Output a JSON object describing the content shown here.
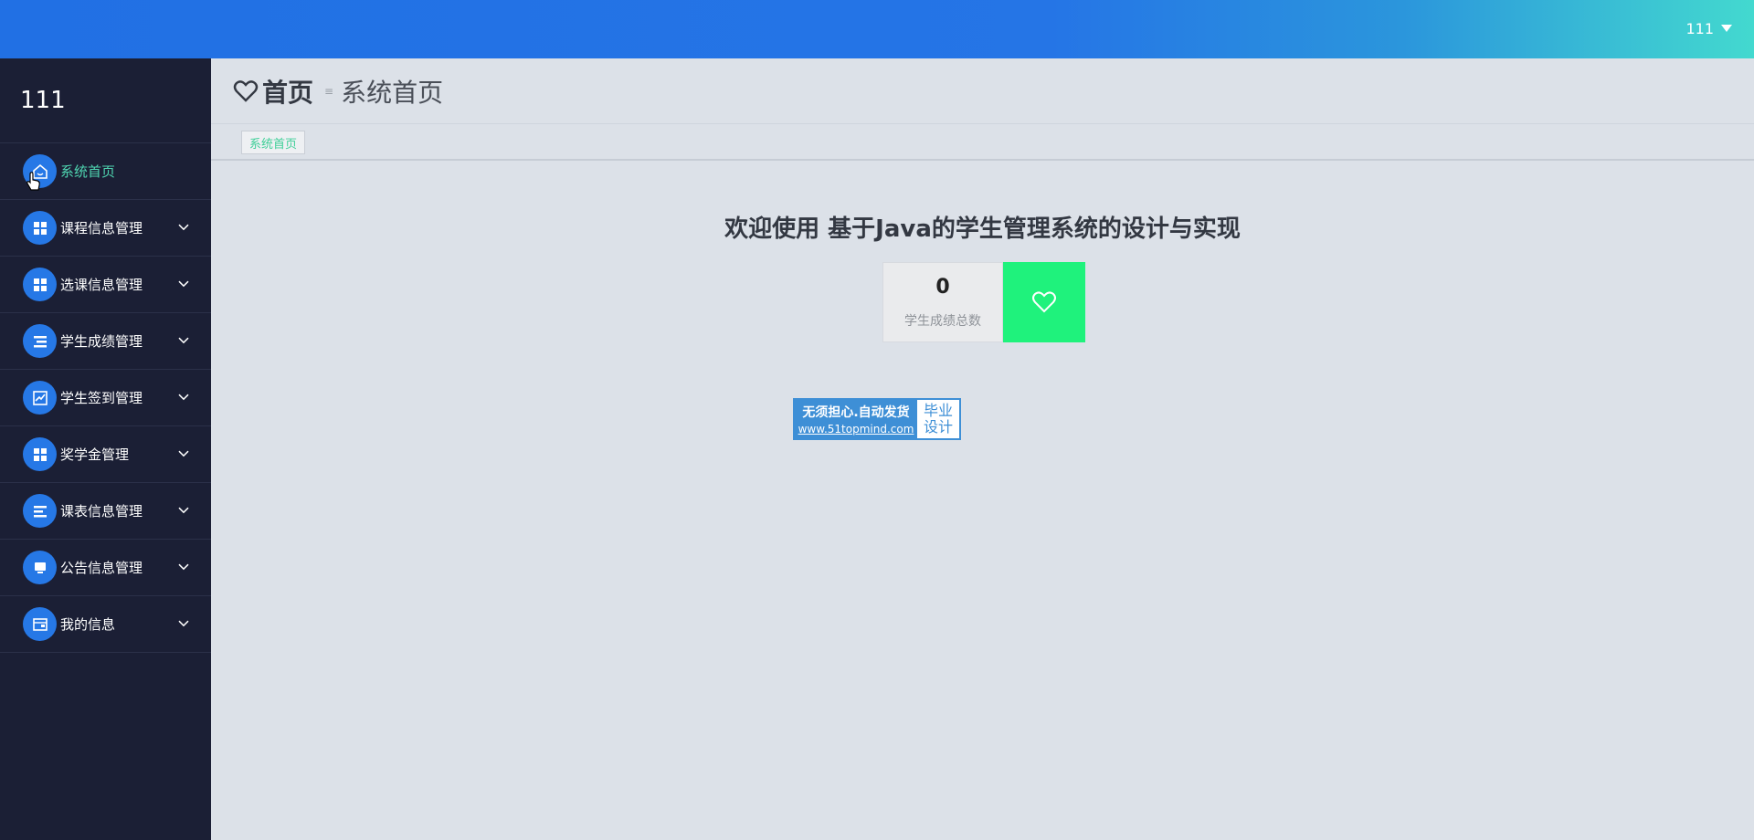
{
  "topbar": {
    "user_label": "111"
  },
  "sidebar": {
    "brand": "111",
    "items": [
      {
        "label": "系统首页",
        "icon": "home-icon",
        "active": true
      },
      {
        "label": "课程信息管理",
        "icon": "grid-icon"
      },
      {
        "label": "选课信息管理",
        "icon": "grid-icon"
      },
      {
        "label": "学生成绩管理",
        "icon": "list-icon"
      },
      {
        "label": "学生签到管理",
        "icon": "chart-icon"
      },
      {
        "label": "奖学金管理",
        "icon": "grid-icon"
      },
      {
        "label": "课表信息管理",
        "icon": "list-icon"
      },
      {
        "label": "公告信息管理",
        "icon": "monitor-icon"
      },
      {
        "label": "我的信息",
        "icon": "card-icon"
      }
    ]
  },
  "breadcrumb": {
    "title": "首页",
    "separator": "≡",
    "current": "系统首页"
  },
  "tabs": [
    {
      "label": "系统首页"
    }
  ],
  "welcome": "欢迎使用 基于Java的学生管理系统的设计与实现",
  "stat": {
    "value": "0",
    "label": "学生成绩总数"
  },
  "ad": {
    "line1": "无须担心.自动发货",
    "line2": "www.51topmind.com",
    "right1": "毕业",
    "right2": "设计"
  },
  "colors": {
    "accent": "#2678e6",
    "active_text": "#4fd6b1",
    "stat_green": "#1ff27c",
    "sidebar_bg": "#1b1f35"
  }
}
